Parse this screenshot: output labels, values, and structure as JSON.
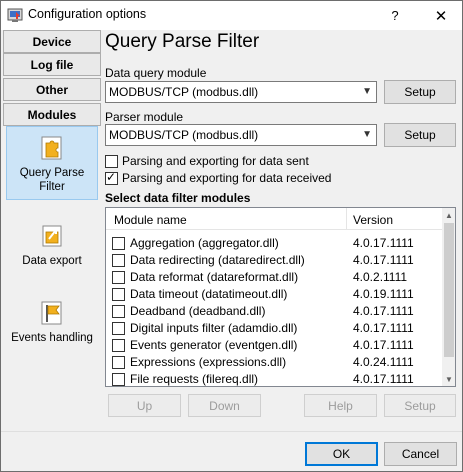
{
  "window": {
    "title": "Configuration options",
    "help_glyph": "?",
    "close_glyph": "✕"
  },
  "nav": {
    "tabs": [
      "Device",
      "Log file",
      "Other",
      "Modules"
    ],
    "items": [
      {
        "label": "Query Parse Filter",
        "icon": "puzzle-piece-icon",
        "active": true
      },
      {
        "label": "Data export",
        "icon": "export-arrow-icon",
        "active": false
      },
      {
        "label": "Events handling",
        "icon": "flag-icon",
        "active": false
      }
    ]
  },
  "page": {
    "title": "Query Parse Filter",
    "data_query_label": "Data query module",
    "data_query_value": "MODBUS/TCP (modbus.dll)",
    "parser_label": "Parser module",
    "parser_value": "MODBUS/TCP (modbus.dll)",
    "setup_label": "Setup",
    "parse_sent_label": "Parsing and exporting for data sent",
    "parse_sent_checked": false,
    "parse_received_label": "Parsing and exporting for data received",
    "parse_received_checked": true,
    "filter_title": "Select data filter modules"
  },
  "filter_table": {
    "columns": [
      "Module name",
      "Version"
    ],
    "rows": [
      {
        "name": "Aggregation (aggregator.dll)",
        "version": "4.0.17.1111"
      },
      {
        "name": "Data redirecting (dataredirect.dll)",
        "version": "4.0.17.1111"
      },
      {
        "name": "Data reformat (datareformat.dll)",
        "version": "4.0.2.1111"
      },
      {
        "name": "Data timeout (datatimeout.dll)",
        "version": "4.0.19.1111"
      },
      {
        "name": "Deadband (deadband.dll)",
        "version": "4.0.17.1111"
      },
      {
        "name": "Digital inputs filter (adamdio.dll)",
        "version": "4.0.17.1111"
      },
      {
        "name": "Events generator (eventgen.dll)",
        "version": "4.0.17.1111"
      },
      {
        "name": "Expressions (expressions.dll)",
        "version": "4.0.24.1111"
      },
      {
        "name": "File requests (filereq.dll)",
        "version": "4.0.17.1111"
      }
    ]
  },
  "list_buttons": {
    "up": "Up",
    "down": "Down",
    "help": "Help",
    "setup": "Setup"
  },
  "footer": {
    "ok": "OK",
    "cancel": "Cancel"
  },
  "colors": {
    "accent": "#0078d7",
    "active_nav": "#cce4f7"
  }
}
